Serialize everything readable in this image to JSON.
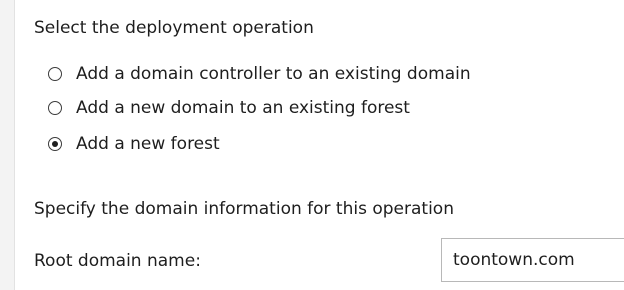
{
  "operation_section": {
    "title": "Select the deployment operation",
    "options": [
      {
        "label": "Add a domain controller to an existing domain",
        "selected": false
      },
      {
        "label": "Add a new domain to an existing forest",
        "selected": false
      },
      {
        "label": "Add a new forest",
        "selected": true
      }
    ]
  },
  "domain_section": {
    "title": "Specify the domain information for this operation",
    "root_domain": {
      "label": "Root domain name:",
      "value": "toontown.com"
    }
  }
}
